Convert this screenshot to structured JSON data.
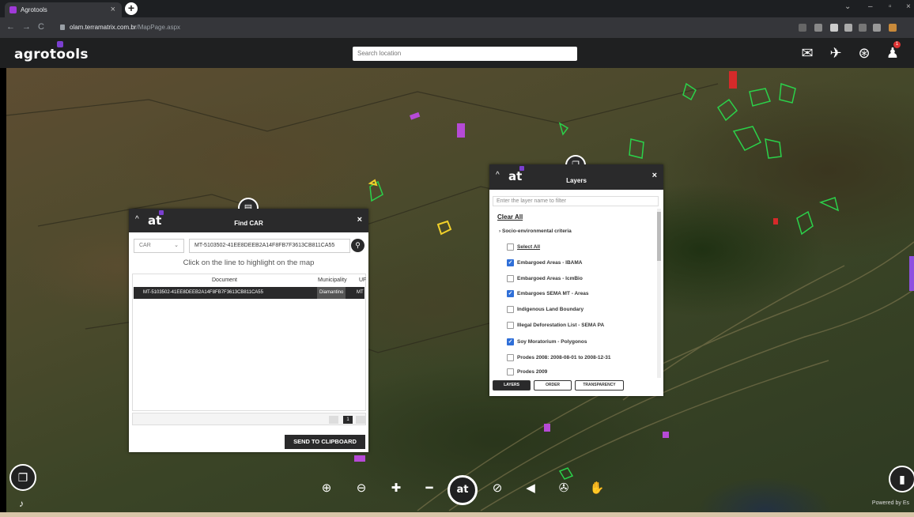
{
  "browser": {
    "tab_title": "Agrotools",
    "tab_close": "×",
    "new_tab": "+",
    "url_host": "olam.terramatrix.com.br",
    "url_path": "/MapPage.aspx"
  },
  "app": {
    "logo": "agrotools",
    "search_placeholder": "Search location",
    "notification_count": "1"
  },
  "find_car": {
    "title": "Find CAR",
    "brand": "at",
    "type_value": "CAR",
    "search_value": "MT-5103502-41EE8DEEB2A14F8FB7F3613CB811CA55",
    "hint": "Click on the line to highlight on the map",
    "columns": [
      "Document",
      "Municipality",
      "UF"
    ],
    "rows": [
      {
        "document": "MT-5103502-41EE8DEEB2A14F8FB7F3613CB811CA55",
        "municipality": "Diamantino",
        "uf": "MT"
      }
    ],
    "pager_current": "1",
    "send_label": "SEND TO CLIPBOARD"
  },
  "layers": {
    "title": "Layers",
    "brand": "at",
    "filter_placeholder": "Enter the layer name to filter",
    "clear_all": "Clear All",
    "group": "Socio-environmental criteria",
    "items": [
      {
        "label": "Select All",
        "checked": false
      },
      {
        "label": "Embargoed Areas - IBAMA",
        "checked": true
      },
      {
        "label": "Embargoed Areas - IcmBio",
        "checked": false
      },
      {
        "label": "Embargoes SEMA MT - Areas",
        "checked": true
      },
      {
        "label": "Indigenous Land Boundary",
        "checked": false
      },
      {
        "label": "Illegal Deforestation List - SEMA PA",
        "checked": false
      },
      {
        "label": "Soy Moratorium - Polygonos",
        "checked": true
      },
      {
        "label": "Prodes 2008: 2008-08-01 to 2008-12-31",
        "checked": false
      },
      {
        "label": "Prodes 2009",
        "checked": false
      }
    ],
    "tabs": [
      "LAYERS",
      "ORDER",
      "TRANSPARENCY"
    ]
  },
  "map": {
    "attribution": "Powered by Es"
  }
}
